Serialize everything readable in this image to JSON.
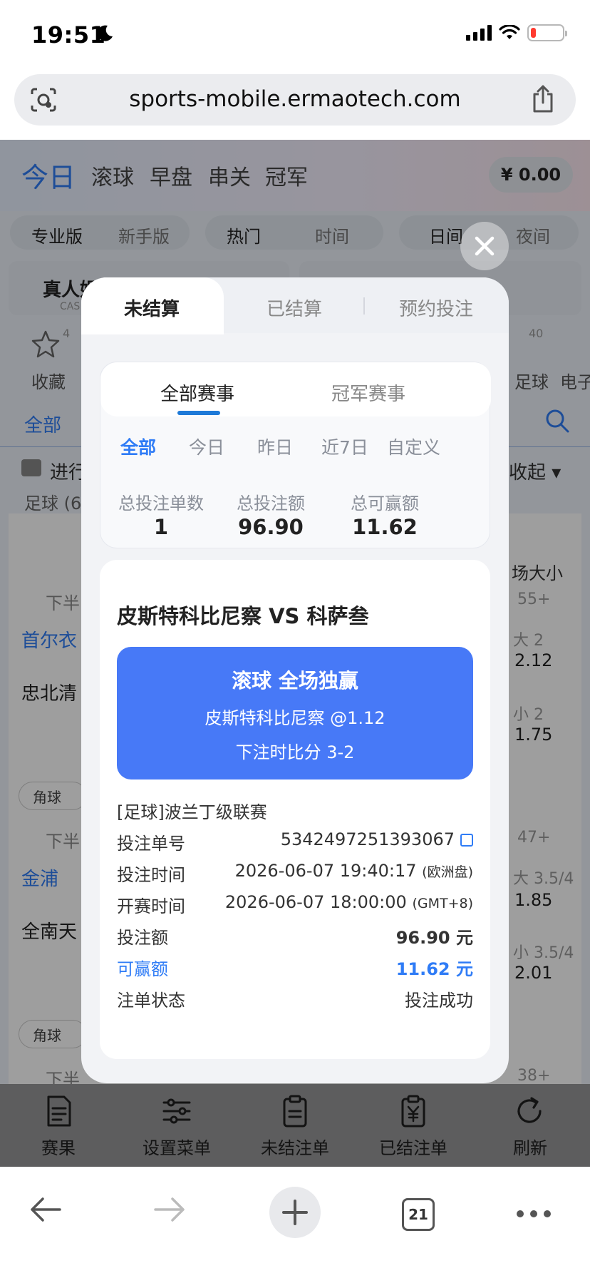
{
  "status_bar": {
    "time": "19:51"
  },
  "url_bar": {
    "url": "sports-mobile.ermaotech.com"
  },
  "background": {
    "nav": [
      "今日",
      "滚球",
      "早盘",
      "串关",
      "冠军"
    ],
    "balance": "¥ 0.00",
    "pill1": [
      "专业版",
      "新手版"
    ],
    "pill2": [
      "热门",
      "时间"
    ],
    "pill3": [
      "日间",
      "夜间"
    ],
    "card1": "真人娱",
    "card1_sub": "CAS",
    "fav_label": "收藏",
    "fav_count": "4",
    "soccer_count": "40",
    "soccer_label": "足球",
    "esports_label": "电子",
    "all_label": "全部",
    "ongoing_label": "进行",
    "collapse_label": "收起 ▾",
    "soccer_section": "足球 (6",
    "second_half": "下半",
    "total_size": "场大小",
    "team1": "首尔衣",
    "team2": "忠北清",
    "team3": "金浦",
    "team4": "全南天",
    "corner": "角球",
    "more1": "55+",
    "more2": "47+",
    "more3": "38+",
    "odds": [
      {
        "label": "大 2",
        "value": "2.12"
      },
      {
        "label": "小 2",
        "value": "1.75"
      },
      {
        "label": "大 3.5/4",
        "value": "1.85"
      },
      {
        "label": "小 3.5/4",
        "value": "2.01"
      }
    ]
  },
  "site_tabs": [
    {
      "label": "赛果",
      "icon": "results-icon"
    },
    {
      "label": "设置菜单",
      "icon": "settings-sliders-icon"
    },
    {
      "label": "未结注单",
      "icon": "unsettled-clipboard-icon"
    },
    {
      "label": "已结注单",
      "icon": "settled-clipboard-icon"
    },
    {
      "label": "刷新",
      "icon": "refresh-icon"
    }
  ],
  "browser_bar": {
    "tab_count": "21"
  },
  "modal": {
    "tabs": [
      "未结算",
      "已结算",
      "预约投注"
    ],
    "segments": [
      "全部赛事",
      "冠军赛事"
    ],
    "ranges": [
      "全部",
      "今日",
      "昨日",
      "近7日",
      "自定义"
    ],
    "stats": [
      {
        "label": "总投注单数",
        "value": "1"
      },
      {
        "label": "总投注额",
        "value": "96.90"
      },
      {
        "label": "总可赢额",
        "value": "11.62"
      }
    ],
    "bet": {
      "match": "皮斯特科比尼察  VS  科萨叁",
      "market": "滚球 全场独赢",
      "selection": "皮斯特科比尼察    @1.12",
      "score": "下注时比分 3-2",
      "league": "[足球]波兰丁级联赛",
      "rows": [
        {
          "key": "投注单号",
          "value": "5342497251393067",
          "note": ""
        },
        {
          "key": "投注时间",
          "value": "2026-06-07 19:40:17",
          "note": "(欧洲盘)"
        },
        {
          "key": "开赛时间",
          "value": "2026-06-07 18:00:00",
          "note": "(GMT+8)"
        },
        {
          "key": "投注额",
          "value": "96.90 元",
          "note": ""
        },
        {
          "key": "可赢额",
          "value": "11.62 元",
          "note": ""
        },
        {
          "key": "注单状态",
          "value": "投注成功",
          "note": ""
        }
      ]
    }
  },
  "colors": {
    "accent": "#4779f7",
    "link_blue": "#2f7cf6",
    "underline": "#1e7ad8"
  }
}
